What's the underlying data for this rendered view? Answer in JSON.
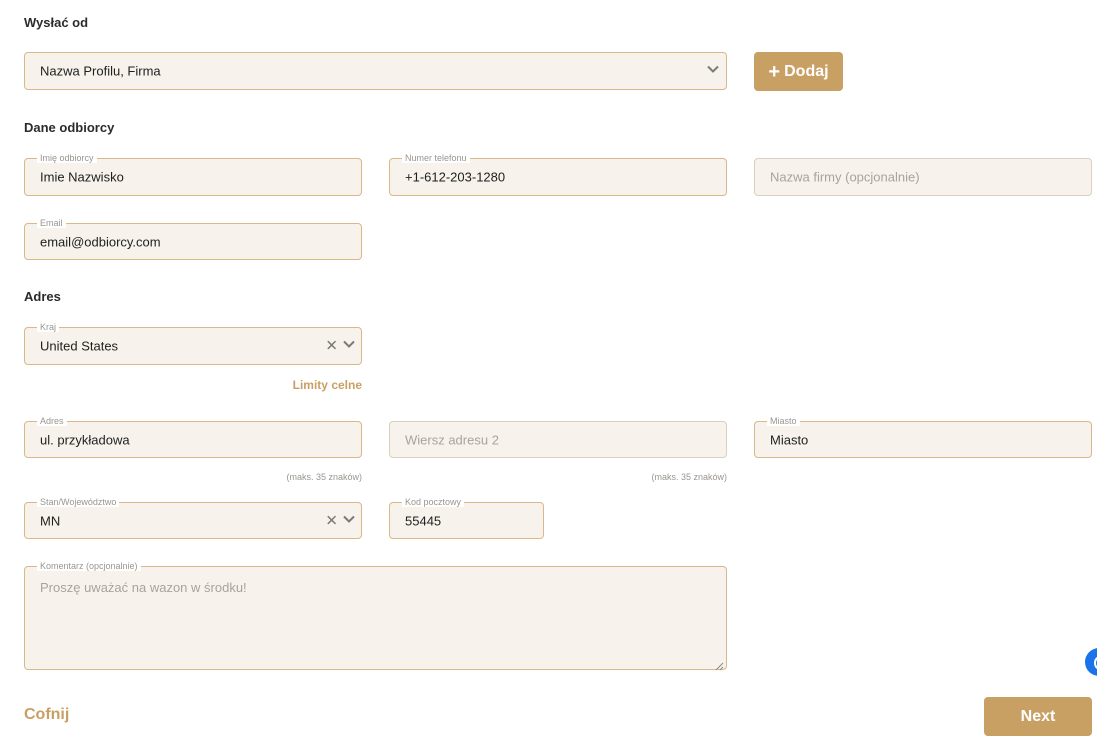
{
  "send_from": {
    "title": "Wysłać od",
    "selected": "Nazwa Profilu, Firma",
    "add_button": "Dodaj",
    "add_icon": "plus-icon"
  },
  "recipient": {
    "title": "Dane odbiorcy",
    "name": {
      "label": "Imię odbiorcy",
      "value": "Imie Nazwisko"
    },
    "phone": {
      "label": "Numer telefonu",
      "value": "+1-612-203-1280"
    },
    "company": {
      "placeholder": "Nazwa firmy (opcjonalnie)"
    },
    "email": {
      "label": "Email",
      "value": "email@odbiorcy.com"
    }
  },
  "address": {
    "title": "Adres",
    "country": {
      "label": "Kraj",
      "value": "United States"
    },
    "customs_link": "Limity celne",
    "line1": {
      "label": "Adres",
      "value": "ul. przykładowa",
      "hint": "(maks. 35 znaków)"
    },
    "line2": {
      "placeholder": "Wiersz adresu 2",
      "hint": "(maks. 35 znaków)"
    },
    "city": {
      "label": "Miasto",
      "value": "Miasto"
    },
    "state": {
      "label": "Stan/Województwo",
      "value": "MN"
    },
    "zip": {
      "label": "Kod pocztowy",
      "value": "55445"
    },
    "comment": {
      "label": "Komentarz (opcjonalnie)",
      "placeholder": "Proszę uważać na wazon w środku!"
    }
  },
  "footer": {
    "back": "Cofnij",
    "next": "Next"
  },
  "colors": {
    "accent": "#c9a064",
    "field_bg": "#f7f3ec",
    "field_border": "#d7b98a"
  }
}
